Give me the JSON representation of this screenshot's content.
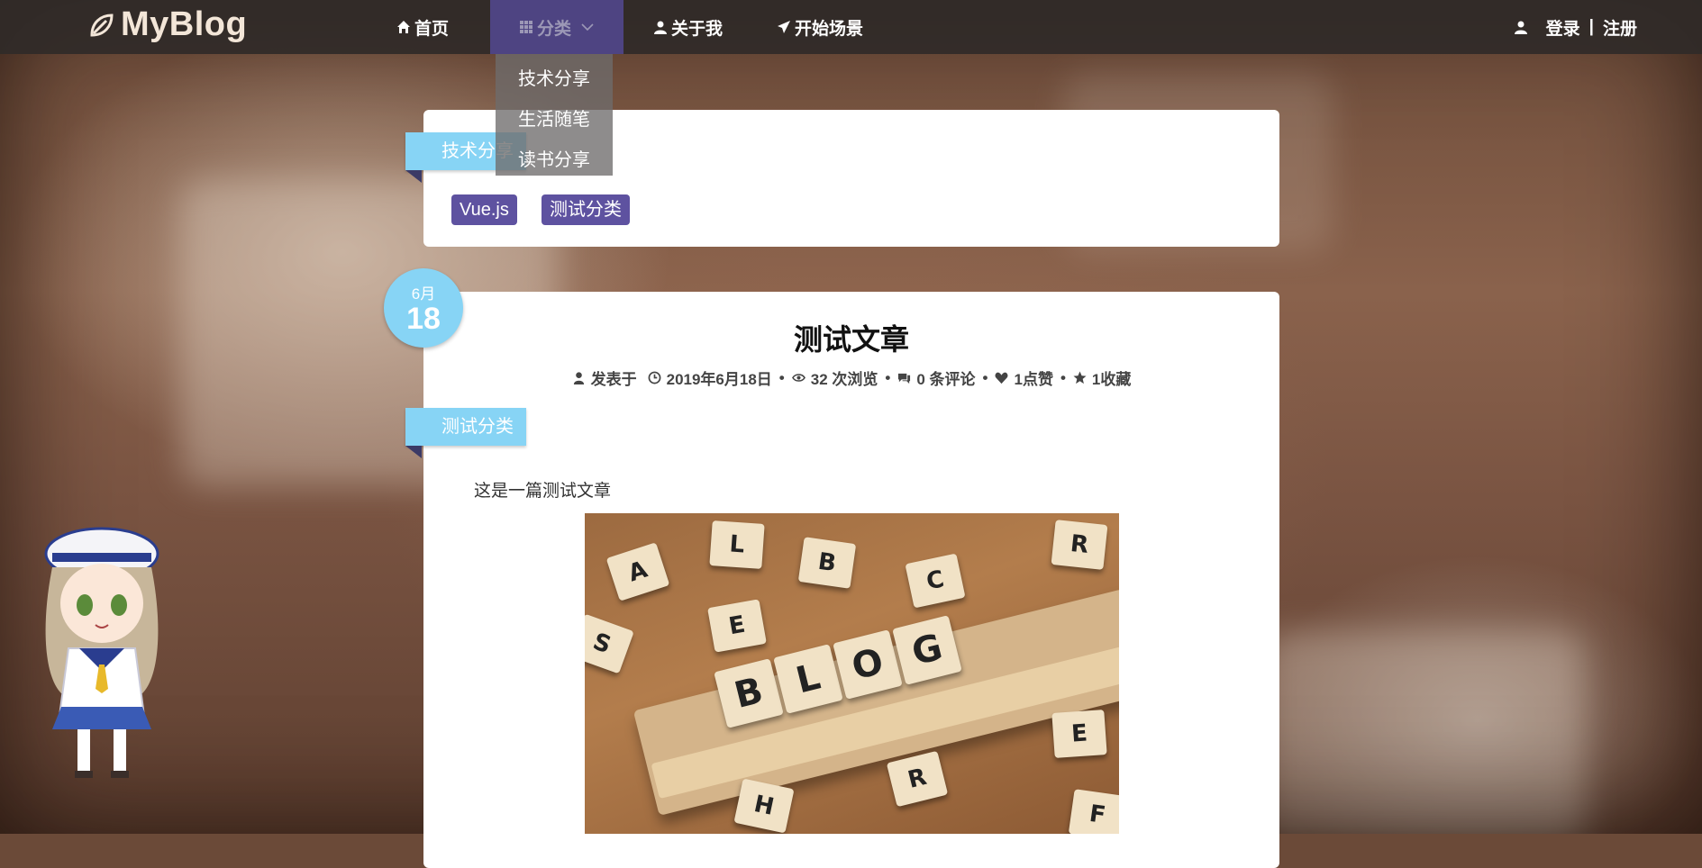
{
  "brand": {
    "name": "MyBlog"
  },
  "nav": {
    "items": [
      {
        "label": "首页",
        "icon": "home-icon"
      },
      {
        "label": "分类",
        "icon": "grid-icon"
      },
      {
        "label": "关于我",
        "icon": "user-icon"
      },
      {
        "label": "开始场景",
        "icon": "send-icon"
      }
    ],
    "auth": {
      "login": "登录",
      "separator": "|",
      "register": "注册"
    }
  },
  "dropdown": {
    "items": [
      "技术分享",
      "生活随笔",
      "读书分享"
    ]
  },
  "category_card": {
    "ribbon": "技术分享",
    "tags": [
      "Vue.js",
      "测试分类"
    ]
  },
  "post": {
    "month": "6月",
    "day": "18",
    "title": "测试文章",
    "meta": {
      "author_label": "发表于",
      "date": "2019年6月18日",
      "views": "32 次浏览",
      "comments": "0 条评论",
      "likes": "1点赞",
      "favorites": "1收藏"
    },
    "category_ribbon": "测试分类",
    "excerpt": "这是一篇测试文章",
    "image_letters": [
      "B",
      "L",
      "O",
      "G"
    ]
  },
  "colors": {
    "accent": "#87d4f5",
    "tag": "#5e52a0",
    "active_nav": "#4e4482"
  }
}
